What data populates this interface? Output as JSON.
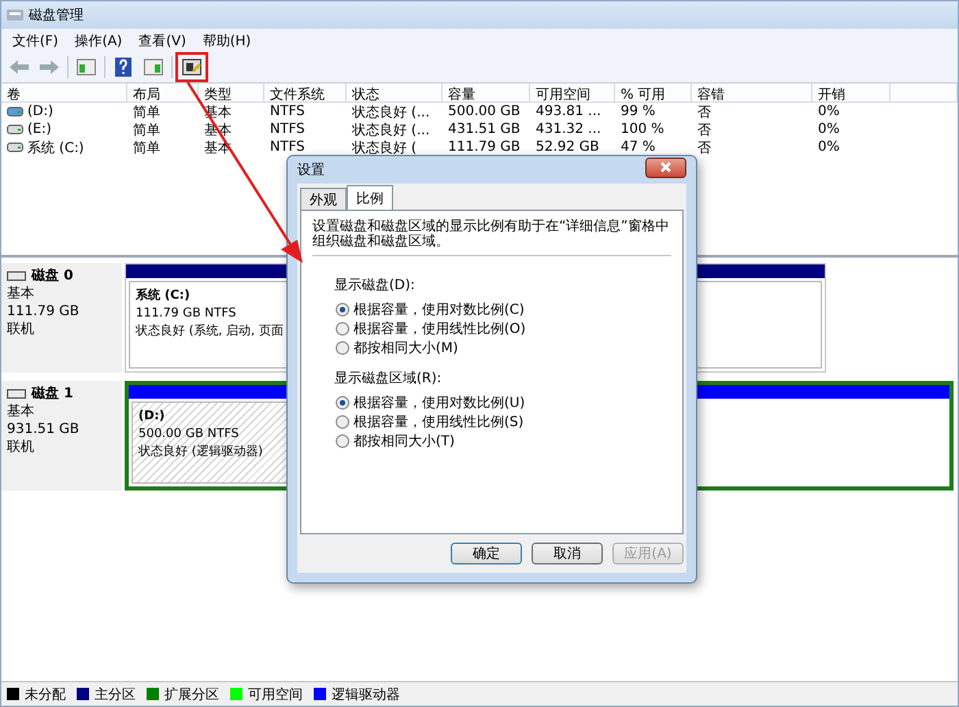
{
  "window": {
    "title": "磁盘管理"
  },
  "menu": [
    {
      "label": "文件(F)"
    },
    {
      "label": "操作(A)"
    },
    {
      "label": "查看(V)"
    },
    {
      "label": "帮助(H)"
    }
  ],
  "table": {
    "columns": [
      "卷",
      "布局",
      "类型",
      "文件系统",
      "状态",
      "容量",
      "可用空间",
      "% 可用",
      "容错",
      "开销"
    ],
    "rows": [
      {
        "kind": "blue",
        "cells": [
          "(D:)",
          "简单",
          "基本",
          "NTFS",
          "状态良好 (...",
          "500.00 GB",
          "493.81 ...",
          "99 %",
          "否",
          "0%"
        ]
      },
      {
        "kind": "grey",
        "cells": [
          "(E:)",
          "简单",
          "基本",
          "NTFS",
          "状态良好 (...",
          "431.51 GB",
          "431.32 ...",
          "100 %",
          "否",
          "0%"
        ]
      },
      {
        "kind": "grey",
        "cells": [
          "系统 (C:)",
          "简单",
          "基本",
          "NTFS",
          "状态良好 (",
          "111.79 GB",
          "52.92 GB",
          "47 %",
          "否",
          "0%"
        ]
      }
    ]
  },
  "disks": [
    {
      "name": "磁盘 0",
      "type": "基本",
      "size": "111.79 GB",
      "status": "联机",
      "selected": false,
      "partitions": [
        {
          "kind": "primary",
          "name": "系统 (C:)",
          "detail": "111.79 GB NTFS",
          "status": "状态良好 (系统, 启动, 页面"
        }
      ]
    },
    {
      "name": "磁盘 1",
      "type": "基本",
      "size": "931.51 GB",
      "status": "联机",
      "selected": true,
      "partitions": [
        {
          "kind": "logical",
          "name": "(D:)",
          "detail": "500.00 GB NTFS",
          "status": "状态良好 (逻辑驱动器)"
        }
      ]
    }
  ],
  "legend": [
    {
      "label": "未分配",
      "color": "#000000"
    },
    {
      "label": "主分区",
      "color": "#000080"
    },
    {
      "label": "扩展分区",
      "color": "#008000"
    },
    {
      "label": "可用空间",
      "color": "#00ff00"
    },
    {
      "label": "逻辑驱动器",
      "color": "#0000ff"
    }
  ],
  "dialog": {
    "title": "设置",
    "tabs": [
      {
        "label": "外观",
        "selected": false
      },
      {
        "label": "比例",
        "selected": true
      }
    ],
    "description": "设置磁盘和磁盘区域的显示比例有助于在“详细信息”窗格中组织磁盘和磁盘区域。",
    "groups": [
      {
        "label": "显示磁盘(D):",
        "options": [
          {
            "label": "根据容量，使用对数比例(C)",
            "selected": true
          },
          {
            "label": "根据容量，使用线性比例(O)",
            "selected": false
          },
          {
            "label": "都按相同大小(M)",
            "selected": false
          }
        ]
      },
      {
        "label": "显示磁盘区域(R):",
        "options": [
          {
            "label": "根据容量，使用对数比例(U)",
            "selected": true
          },
          {
            "label": "根据容量，使用线性比例(S)",
            "selected": false
          },
          {
            "label": "都按相同大小(T)",
            "selected": false
          }
        ]
      }
    ],
    "buttons": [
      {
        "label": "确定",
        "disabled": false,
        "default": true
      },
      {
        "label": "取消",
        "disabled": false,
        "default": false
      },
      {
        "label": "应用(A)",
        "disabled": true,
        "default": false
      }
    ]
  }
}
